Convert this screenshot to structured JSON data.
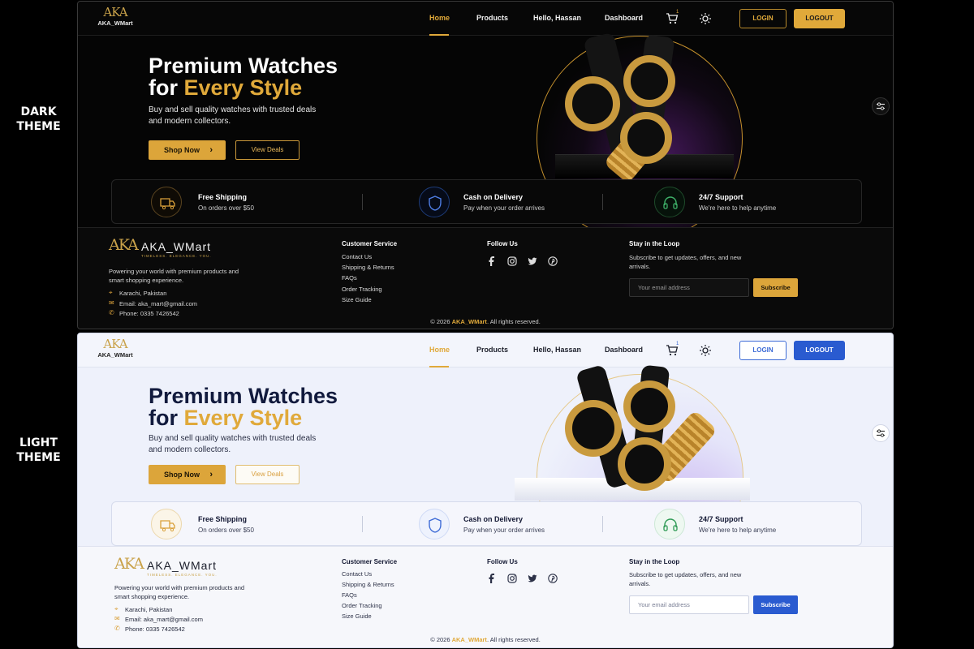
{
  "labels": {
    "dark": "DARK\nTHEME",
    "dark_1": "DARK",
    "dark_2": "THEME",
    "light_1": "LIGHT",
    "light_2": "THEME"
  },
  "brand": {
    "monogram": "AKA",
    "name": "AKA_WMart",
    "tagline": "TIMELESS. ELEGANCE. YOU."
  },
  "nav": {
    "links": [
      "Home",
      "Products",
      "Hello, Hassan",
      "Dashboard"
    ],
    "active": "Home",
    "cart_count": "1",
    "login": "LOGIN",
    "logout": "LOGOUT"
  },
  "hero": {
    "title_line1": "Premium Watches",
    "title_line2_prefix": "for ",
    "title_line2_accent": "Every Style",
    "subtitle": "Buy and sell quality watches with trusted deals and modern collectors.",
    "shop_now": "Shop Now",
    "view_deals": "View Deals"
  },
  "features": [
    {
      "icon": "truck-icon",
      "title": "Free Shipping",
      "subtitle": "On orders over $50"
    },
    {
      "icon": "shield-icon",
      "title": "Cash on Delivery",
      "subtitle": "Pay when your order arrives"
    },
    {
      "icon": "headset-icon",
      "title": "24/7 Support",
      "subtitle": "We're here to help anytime"
    }
  ],
  "footer": {
    "about": "Powering your world with premium products and smart shopping experience.",
    "location": "Karachi, Pakistan",
    "email": "Email: aka_mart@gmail.com",
    "phone": "Phone: 0335 7426542",
    "customer_service_title": "Customer Service",
    "customer_service_links": [
      "Contact Us",
      "Shipping & Returns",
      "FAQs",
      "Order Tracking",
      "Size Guide"
    ],
    "follow_title": "Follow Us",
    "social": [
      "facebook-icon",
      "instagram-icon",
      "twitter-icon",
      "pinterest-icon"
    ],
    "newsletter_title": "Stay in the Loop",
    "newsletter_text": "Subscribe to get updates, offers, and new arrivals.",
    "email_placeholder": "Your email address",
    "subscribe": "Subscribe",
    "copyright_prefix": "© 2026 ",
    "copyright_brand": "AKA_WMart",
    "copyright_suffix": ". All rights reserved."
  },
  "colors": {
    "gold": "#e0a93a",
    "dark_bg": "#050505",
    "light_bg": "#eef1fb",
    "blue": "#2a5bd0"
  }
}
